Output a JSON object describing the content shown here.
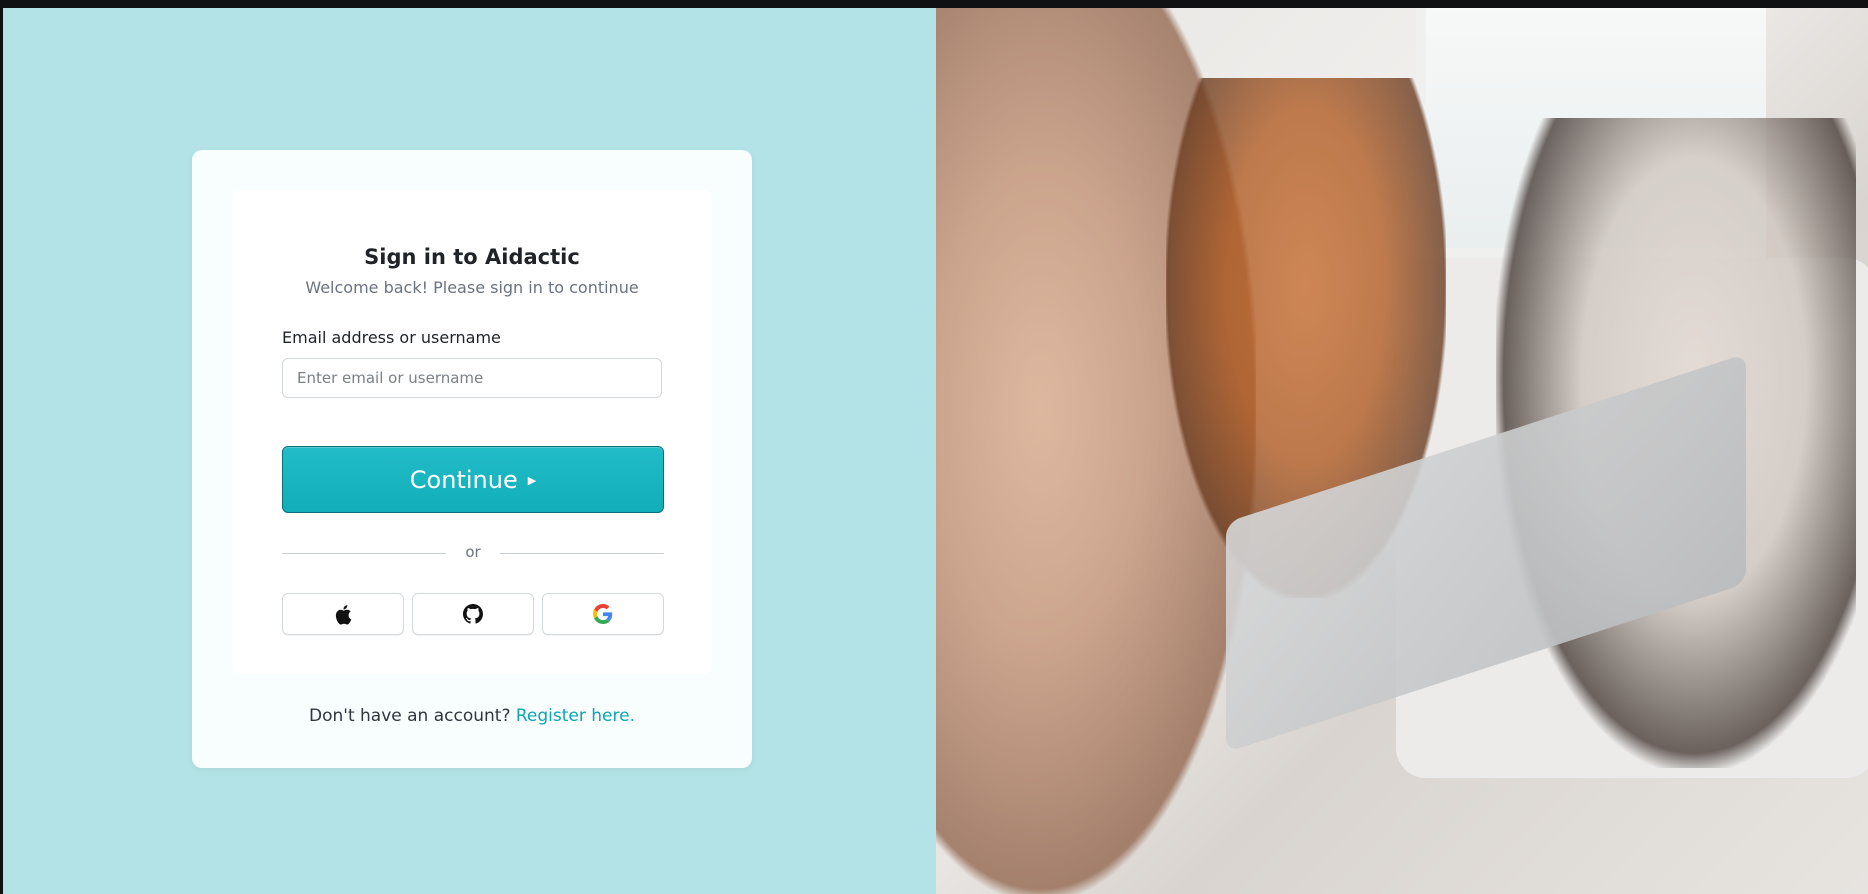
{
  "signin": {
    "title": "Sign in to Aidactic",
    "subtitle": "Welcome back! Please sign in to continue",
    "email_label": "Email address or username",
    "email_placeholder": "Enter email or username",
    "email_value": "",
    "continue_label": "Continue",
    "continue_icon": "caret-right-icon",
    "divider_text": "or",
    "social": [
      {
        "name": "apple",
        "icon": "apple-icon"
      },
      {
        "name": "github",
        "icon": "github-icon"
      },
      {
        "name": "google",
        "icon": "google-icon"
      }
    ],
    "register_prompt": "Don't have an account?",
    "register_link": "Register here."
  },
  "colors": {
    "left_background": "#b3e3e6",
    "accent": "#11aeb9",
    "link": "#0ea5b0"
  }
}
